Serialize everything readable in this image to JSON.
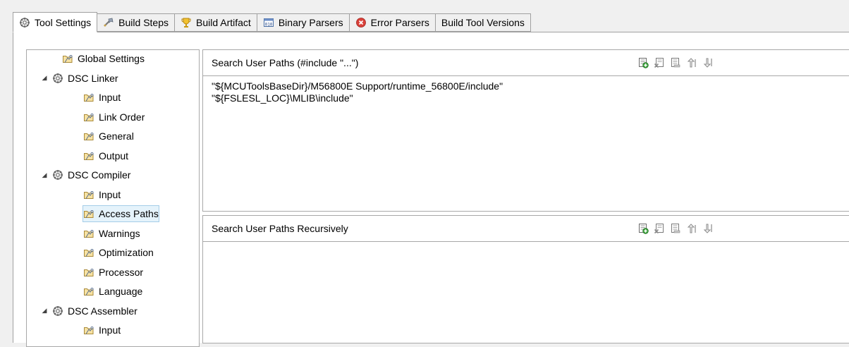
{
  "tabs": [
    {
      "label": "Tool Settings",
      "icon": "tool-settings-icon",
      "active": true
    },
    {
      "label": "Build Steps",
      "icon": "build-steps-icon",
      "active": false
    },
    {
      "label": "Build Artifact",
      "icon": "build-artifact-icon",
      "active": false
    },
    {
      "label": "Binary Parsers",
      "icon": "binary-parsers-icon",
      "active": false
    },
    {
      "label": "Error Parsers",
      "icon": "error-parsers-icon",
      "active": false
    },
    {
      "label": "Build Tool Versions",
      "icon": "",
      "active": false
    }
  ],
  "tree": [
    {
      "label": "Global Settings"
    },
    {
      "label": "DSC Linker"
    },
    {
      "label": "Input"
    },
    {
      "label": "Link Order"
    },
    {
      "label": "General"
    },
    {
      "label": "Output"
    },
    {
      "label": "DSC Compiler"
    },
    {
      "label": "Input"
    },
    {
      "label": "Access Paths",
      "selected": true
    },
    {
      "label": "Warnings"
    },
    {
      "label": "Optimization"
    },
    {
      "label": "Processor"
    },
    {
      "label": "Language"
    },
    {
      "label": "DSC Assembler"
    },
    {
      "label": "Input"
    }
  ],
  "user_paths": {
    "title": "Search User Paths (#include \"...\")",
    "items": [
      "\"${MCUToolsBaseDir}/M56800E Support/runtime_56800E/include\"",
      "\"${FSLESL_LOC}\\MLIB\\include\""
    ]
  },
  "recursive_paths": {
    "title": "Search User Paths Recursively",
    "items": []
  },
  "toolbar_icons": [
    "add-icon",
    "delete-icon",
    "edit-icon",
    "move-up-icon",
    "move-down-icon"
  ],
  "colors": {
    "selection_bg": "#e5f3fb",
    "selection_border": "#a5cde8",
    "border": "#a0a0a0",
    "error_red": "#d32f2f",
    "artifact_gold": "#e6a817"
  }
}
